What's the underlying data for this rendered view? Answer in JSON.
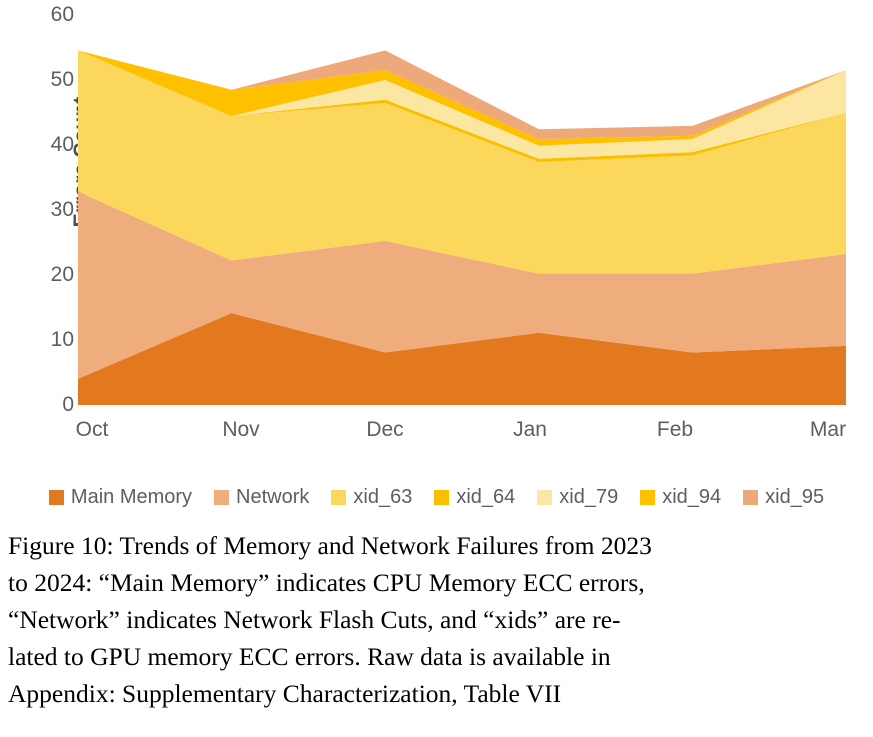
{
  "figure": {
    "caption_lines": [
      "Figure 10: Trends of Memory and Network Failures from 2023",
      "to 2024: “Main Memory” indicates CPU Memory ECC errors,",
      "“Network” indicates Network Flash Cuts, and “xids” are re-",
      "lated to GPU memory ECC errors. Raw data is available in",
      "Appendix: Supplementary Characterization, Table VII"
    ]
  },
  "chart_data": {
    "type": "area",
    "stacked": true,
    "title": "",
    "xlabel": "",
    "ylabel": "Errors Count",
    "categories": [
      "Oct",
      "Nov",
      "Dec",
      "Jan",
      "Feb",
      "Mar"
    ],
    "ylim": [
      0,
      60
    ],
    "yticks": [
      0,
      10,
      20,
      30,
      40,
      50,
      60
    ],
    "grid": false,
    "legend_position": "bottom",
    "series": [
      {
        "name": "Main Memory",
        "color": "#E3791F",
        "values": [
          4,
          14,
          8,
          11,
          8,
          9
        ]
      },
      {
        "name": "Network",
        "color": "#EFAC7D",
        "values": [
          28.5,
          8,
          17,
          9,
          12,
          14
        ]
      },
      {
        "name": "xid_63",
        "color": "#FBD75B",
        "values": [
          21.5,
          22,
          21,
          17,
          18,
          21.5
        ]
      },
      {
        "name": "xid_64",
        "color": "#FAC000",
        "values": [
          0,
          0,
          0.5,
          0.5,
          0.5,
          0
        ]
      },
      {
        "name": "xid_79",
        "color": "#FBE7A1",
        "values": [
          0,
          0,
          3,
          2,
          2,
          6.5
        ]
      },
      {
        "name": "xid_94",
        "color": "#FFC000",
        "values": [
          0,
          4,
          1.5,
          1,
          0.5,
          0
        ]
      },
      {
        "name": "xid_95",
        "color": "#EDA97A",
        "values": [
          0,
          0,
          3,
          1.5,
          1.5,
          0
        ]
      }
    ],
    "cumulative_tops": {
      "Main Memory": [
        4,
        14,
        8,
        11,
        8,
        9
      ],
      "Network": [
        32.5,
        22,
        25,
        20,
        20,
        23
      ],
      "xid_63": [
        54,
        44,
        46,
        37,
        38,
        44.5
      ],
      "xid_64": [
        54,
        44,
        46.5,
        37.5,
        38.5,
        44.5
      ],
      "xid_79": [
        54,
        44,
        49.5,
        39.5,
        40.5,
        51
      ],
      "xid_94": [
        54,
        48,
        51,
        40.5,
        41,
        51
      ],
      "xid_95": [
        54,
        48,
        54,
        42,
        42.5,
        51
      ]
    }
  }
}
